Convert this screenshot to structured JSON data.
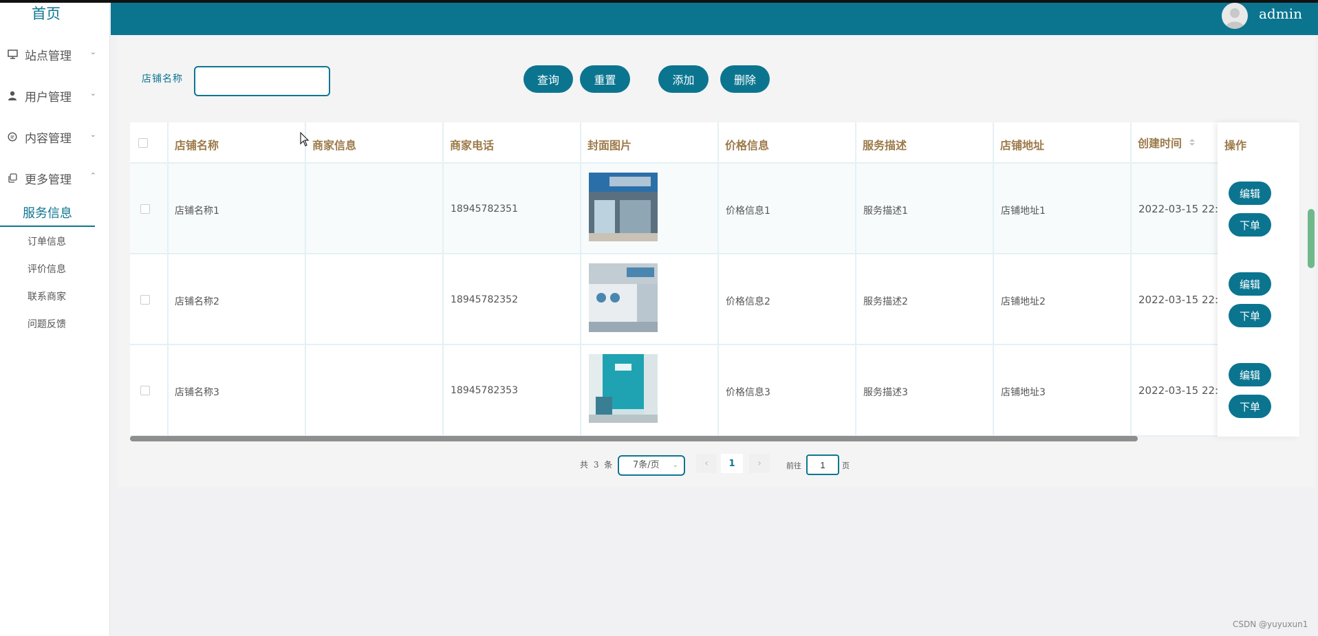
{
  "sidebar": {
    "home": "首页",
    "menus": [
      {
        "label": "站点管理",
        "icon": "monitor-icon"
      },
      {
        "label": "用户管理",
        "icon": "user-icon"
      },
      {
        "label": "内容管理",
        "icon": "chat-icon"
      },
      {
        "label": "更多管理",
        "icon": "copy-icon"
      }
    ],
    "active_sub": "服务信息",
    "sub_items": [
      "订单信息",
      "评价信息",
      "联系商家",
      "问题反馈"
    ]
  },
  "header": {
    "username": "admin",
    "color": "#0b7590"
  },
  "search": {
    "label": "店铺名称",
    "value": "",
    "query_button": "查询",
    "reset_button": "重置",
    "add_button": "添加",
    "delete_button": "删除"
  },
  "table": {
    "columns": [
      "店铺名称",
      "商家信息",
      "商家电话",
      "封面图片",
      "价格信息",
      "服务描述",
      "店铺地址",
      "创建时间",
      "操作"
    ],
    "rows": [
      {
        "name": "店铺名称1",
        "merchant": "",
        "phone": "18945782351",
        "price": "价格信息1",
        "desc": "服务描述1",
        "address": "店铺地址1",
        "created": "2022-03-15 22:",
        "edit": "编辑",
        "order": "下单"
      },
      {
        "name": "店铺名称2",
        "merchant": "",
        "phone": "18945782352",
        "price": "价格信息2",
        "desc": "服务描述2",
        "address": "店铺地址2",
        "created": "2022-03-15 22:",
        "edit": "编辑",
        "order": "下单"
      },
      {
        "name": "店铺名称3",
        "merchant": "",
        "phone": "18945782353",
        "price": "价格信息3",
        "desc": "服务描述3",
        "address": "店铺地址3",
        "created": "2022-03-15 22:",
        "edit": "编辑",
        "order": "下单"
      }
    ]
  },
  "pagination": {
    "total": "共 3 条",
    "page_size": "7条/页",
    "current_page": "1",
    "goto_label": "前往",
    "goto_value": "1",
    "goto_suffix": "页"
  },
  "watermark": "CSDN @yuyuxun1"
}
